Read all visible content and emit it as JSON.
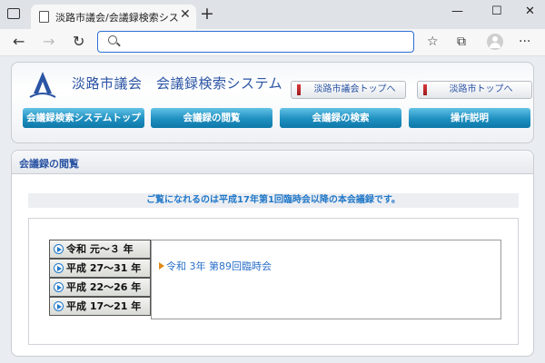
{
  "browser": {
    "tab_title": "淡路市議会/会議録検索システム",
    "tab_close": "✕",
    "new_tab": "+",
    "window_controls": [
      "—",
      "☐",
      "✕"
    ],
    "address_value": "",
    "nav": {
      "back": "←",
      "forward": "→",
      "reload": "↻"
    },
    "toolbar_icons": {
      "favorites": "☆",
      "collections": "⧉",
      "more": "···"
    }
  },
  "header": {
    "site_title": "淡路市議会　会議録検索システム",
    "top_links": [
      "淡路市議会トップへ",
      "淡路市トップへ"
    ],
    "menu": [
      "会議録検索システムトップ",
      "会議録の閲覧",
      "会議録の検索",
      "操作説明"
    ],
    "colors": {
      "accent": "#2b54a4",
      "menu_blue": "#1e8fc0",
      "link_blue": "#2178c8"
    }
  },
  "content": {
    "section_title": "会議録の閲覧",
    "notice": "ご覧になれるのは平成17年第1回臨時会以降の本会議録です。",
    "eras": [
      "令和 元～３ 年",
      "平成 27～31 年",
      "平成 22～26 年",
      "平成 17～21 年"
    ],
    "sessions": [
      "令和 3年 第89回臨時会"
    ]
  }
}
